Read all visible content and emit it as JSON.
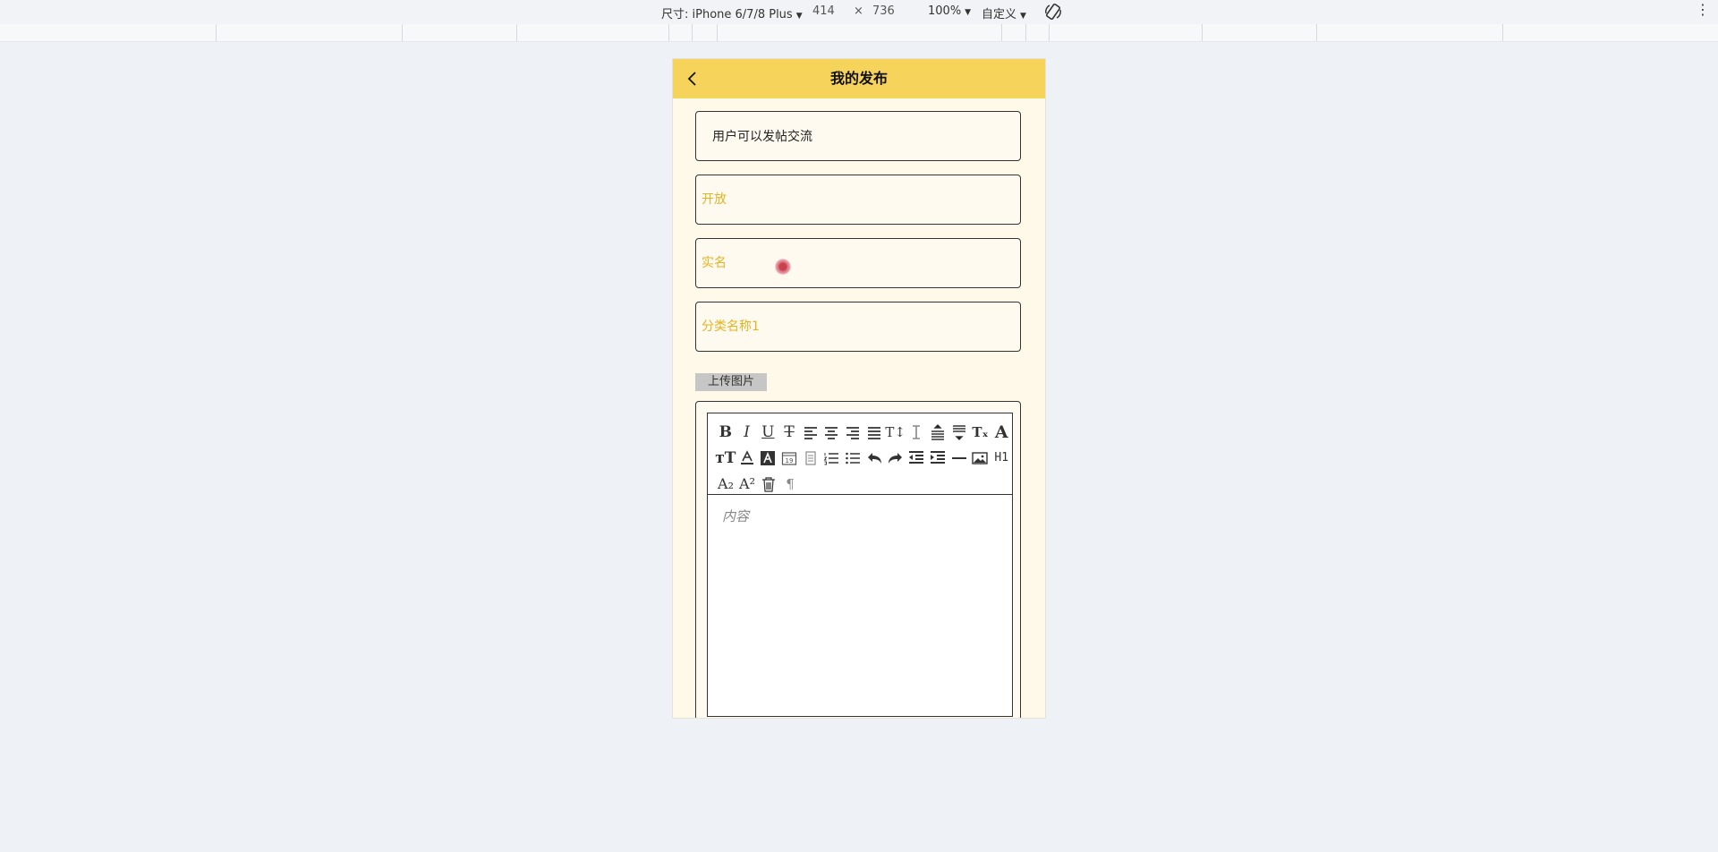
{
  "devtools": {
    "device_label": "尺寸: iPhone 6/7/8 Plus",
    "width": "414",
    "times": "×",
    "height": "736",
    "zoom": "100%",
    "throttle": "自定义"
  },
  "app": {
    "title": "我的发布",
    "fields": {
      "post_title": "用户可以发帖交流",
      "visibility": "开放",
      "name_mode": "实名",
      "category": "分类名称1"
    },
    "upload_label": "上传图片",
    "editor": {
      "placeholder": "内容",
      "toolbar_rows": [
        [
          "bold-icon",
          "italic-icon",
          "underline-icon",
          "strikethrough-icon",
          "align-left-icon",
          "align-center-icon",
          "align-right-icon",
          "align-justify-icon",
          "font-size-icon",
          "line-height-icon",
          "paragraph-spacing-above-icon",
          "paragraph-spacing-below-icon",
          "clear-format-icon",
          "font-icon"
        ],
        [
          "text-size-icon",
          "font-color-icon",
          "background-color-icon",
          "date-icon",
          "list-box-icon",
          "ordered-list-icon",
          "unordered-list-icon",
          "undo-icon",
          "redo-icon",
          "outdent-icon",
          "indent-icon",
          "horizontal-rule-icon",
          "image-icon",
          "heading-icon"
        ],
        [
          "subscript-icon",
          "superscript-icon",
          "delete-icon",
          "paragraph-direction-icon"
        ]
      ]
    }
  }
}
